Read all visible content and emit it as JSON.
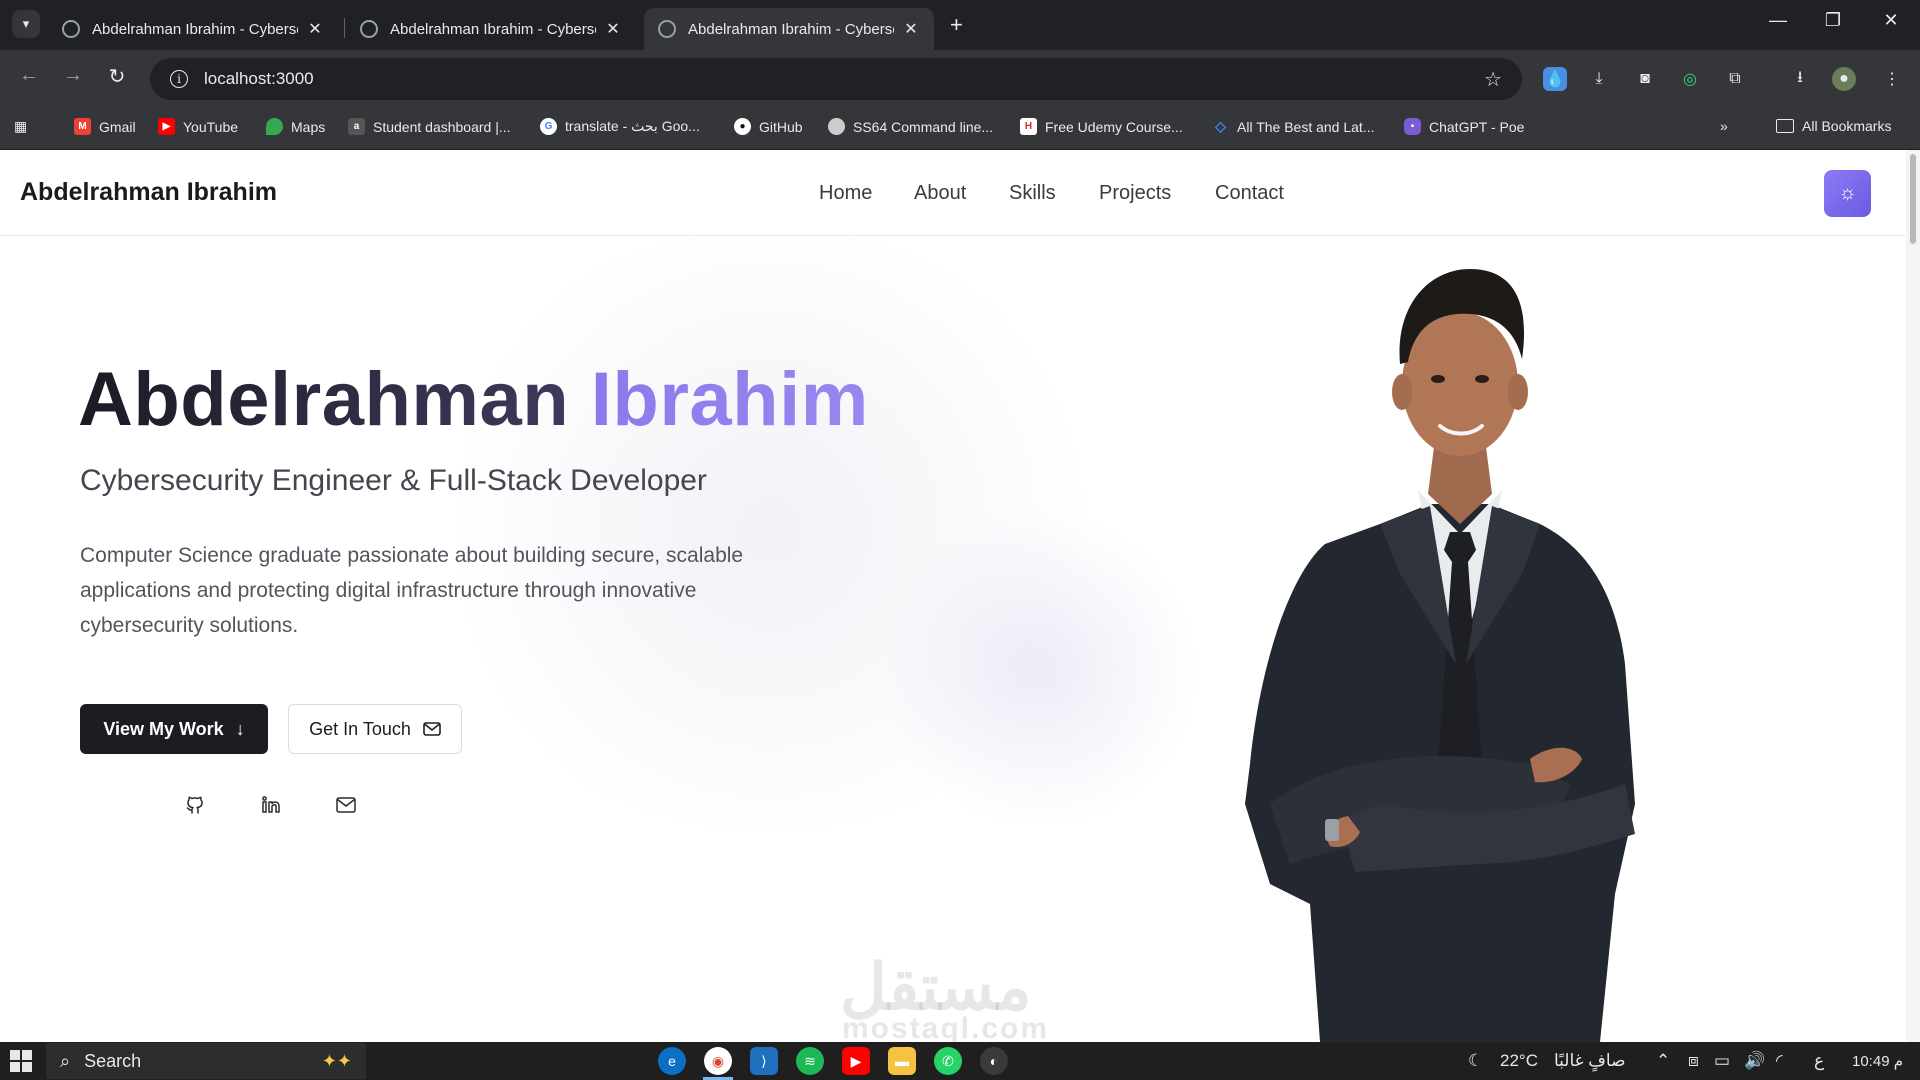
{
  "browser": {
    "tabs": [
      {
        "title": "Abdelrahman Ibrahim - Cybersecurity Engineer",
        "active": false
      },
      {
        "title": "Abdelrahman Ibrahim - Cybersecurity Engineer",
        "active": false
      },
      {
        "title": "Abdelrahman Ibrahim - Cybersecurity Engineer",
        "active": true
      }
    ],
    "url": "localhost:3000",
    "bookmarks": [
      {
        "label": "Gmail",
        "icon": "gmail-icon",
        "color": "#ea4335"
      },
      {
        "label": "YouTube",
        "icon": "youtube-icon",
        "color": "#ff0000"
      },
      {
        "label": "Maps",
        "icon": "maps-icon",
        "color": "#34a853"
      },
      {
        "label": "Student dashboard |...",
        "icon": "alx-icon",
        "color": "#555555"
      },
      {
        "label": "translate - بحث Goo...",
        "icon": "google-icon",
        "color": "#4285f4"
      },
      {
        "label": "GitHub",
        "icon": "github-icon",
        "color": "#ffffff"
      },
      {
        "label": "SS64 Command line...",
        "icon": "ss64-icon",
        "color": "#cccccc"
      },
      {
        "label": "Free Udemy Course...",
        "icon": "udemy-icon",
        "color": "#d32f2f"
      },
      {
        "label": "All The Best and Lat...",
        "icon": "diamond-icon",
        "color": "#3b82f6"
      },
      {
        "label": "ChatGPT - Poe",
        "icon": "poe-icon",
        "color": "#7c5cd6"
      }
    ],
    "all_bookmarks": "All Bookmarks"
  },
  "site": {
    "brand": "Abdelrahman Ibrahim",
    "nav": [
      "Home",
      "About",
      "Skills",
      "Projects",
      "Contact"
    ],
    "hero": {
      "first_name": "Abdelrahman",
      "last_name": "Ibrahim",
      "subtitle": "Cybersecurity Engineer & Full-Stack Developer",
      "description": "Computer Science graduate passionate about building secure, scalable applications and protecting digital infrastructure through innovative cybersecurity solutions.",
      "primary_button": "View My Work",
      "secondary_button": "Get In Touch"
    },
    "socials": [
      "github-icon",
      "linkedin-icon",
      "mail-icon"
    ],
    "accent": "#8b7cf6",
    "watermark": "مستقل",
    "watermark_sub": "mostaql.com"
  },
  "taskbar": {
    "search": "Search",
    "weather": "22°C",
    "weather_text": "صافٍ غالبًا",
    "lang": "ع",
    "time": "10:49 م"
  }
}
